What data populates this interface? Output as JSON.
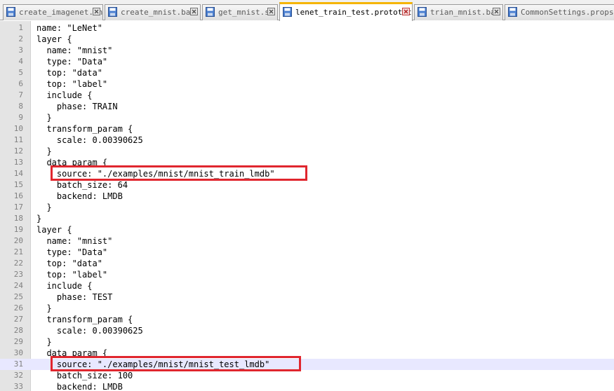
{
  "tabs": [
    {
      "label": "create_imagenet.sh",
      "active": false,
      "icon": "file-saved-icon"
    },
    {
      "label": "create_mnist.bat",
      "active": false,
      "icon": "file-saved-icon"
    },
    {
      "label": "get_mnist.sh",
      "active": false,
      "icon": "file-saved-icon"
    },
    {
      "label": "lenet_train_test.prototxt",
      "active": true,
      "icon": "file-saved-icon"
    },
    {
      "label": "trian_mnist.bat",
      "active": false,
      "icon": "file-saved-icon"
    },
    {
      "label": "CommonSettings.props",
      "active": false,
      "icon": "file-saved-icon"
    }
  ],
  "colors": {
    "active_tab_accent": "#f5b400",
    "highlight_box": "#e0262e",
    "current_line": "#e8e8ff",
    "gutter": "#e4e4e4"
  },
  "editor": {
    "current_line": 31,
    "highlighted_lines": [
      14,
      31
    ],
    "lines": [
      {
        "n": "1",
        "text": "name: \"LeNet\""
      },
      {
        "n": "2",
        "text": "layer {"
      },
      {
        "n": "3",
        "text": "  name: \"mnist\""
      },
      {
        "n": "4",
        "text": "  type: \"Data\""
      },
      {
        "n": "5",
        "text": "  top: \"data\""
      },
      {
        "n": "6",
        "text": "  top: \"label\""
      },
      {
        "n": "7",
        "text": "  include {"
      },
      {
        "n": "8",
        "text": "    phase: TRAIN"
      },
      {
        "n": "9",
        "text": "  }"
      },
      {
        "n": "10",
        "text": "  transform_param {"
      },
      {
        "n": "11",
        "text": "    scale: 0.00390625"
      },
      {
        "n": "12",
        "text": "  }"
      },
      {
        "n": "13",
        "text": "  data_param {"
      },
      {
        "n": "14",
        "text": "    source: \"./examples/mnist/mnist_train_lmdb\""
      },
      {
        "n": "15",
        "text": "    batch_size: 64"
      },
      {
        "n": "16",
        "text": "    backend: LMDB"
      },
      {
        "n": "17",
        "text": "  }"
      },
      {
        "n": "18",
        "text": "}"
      },
      {
        "n": "19",
        "text": "layer {"
      },
      {
        "n": "20",
        "text": "  name: \"mnist\""
      },
      {
        "n": "21",
        "text": "  type: \"Data\""
      },
      {
        "n": "22",
        "text": "  top: \"data\""
      },
      {
        "n": "23",
        "text": "  top: \"label\""
      },
      {
        "n": "24",
        "text": "  include {"
      },
      {
        "n": "25",
        "text": "    phase: TEST"
      },
      {
        "n": "26",
        "text": "  }"
      },
      {
        "n": "27",
        "text": "  transform_param {"
      },
      {
        "n": "28",
        "text": "    scale: 0.00390625"
      },
      {
        "n": "29",
        "text": "  }"
      },
      {
        "n": "30",
        "text": "  data_param {"
      },
      {
        "n": "31",
        "text": "    source: \"./examples/mnist/mnist_test_lmdb\""
      },
      {
        "n": "32",
        "text": "    batch_size: 100"
      },
      {
        "n": "33",
        "text": "    backend: LMDB"
      }
    ]
  }
}
